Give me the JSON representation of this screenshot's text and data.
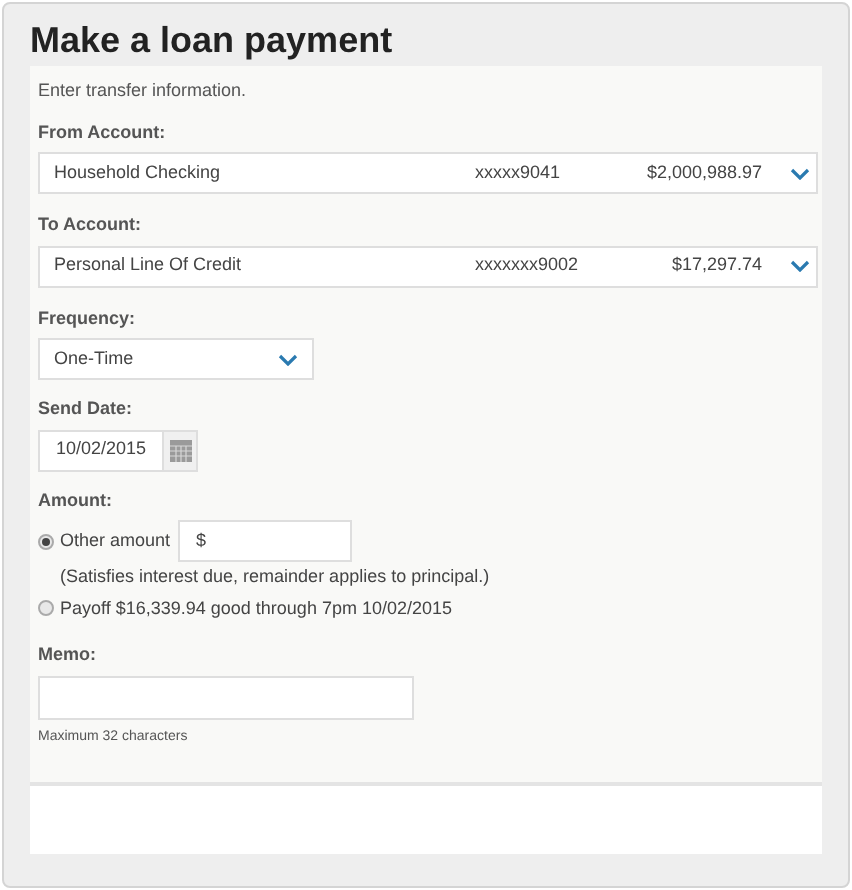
{
  "title": "Make a loan payment",
  "intro": "Enter transfer information.",
  "from_account": {
    "label": "From Account:",
    "name": "Household Checking",
    "number": "xxxxx9041",
    "balance": "$2,000,988.97"
  },
  "to_account": {
    "label": "To Account:",
    "name": "Personal Line Of Credit",
    "number": "xxxxxxx9002",
    "balance": "$17,297.74"
  },
  "frequency": {
    "label": "Frequency:",
    "value": "One-Time"
  },
  "send_date": {
    "label": "Send Date:",
    "value": "10/02/2015"
  },
  "amount": {
    "label": "Amount:",
    "options": [
      {
        "kind": "input",
        "label": "Other amount",
        "value": "$",
        "note": "(Satisfies interest due, remainder applies to principal.)",
        "selected": true
      },
      {
        "kind": "text",
        "label": "Payoff $16,339.94 good through 7pm 10/02/2015",
        "selected": false
      }
    ]
  },
  "memo": {
    "label": "Memo:",
    "hint": "Maximum 32 characters"
  }
}
